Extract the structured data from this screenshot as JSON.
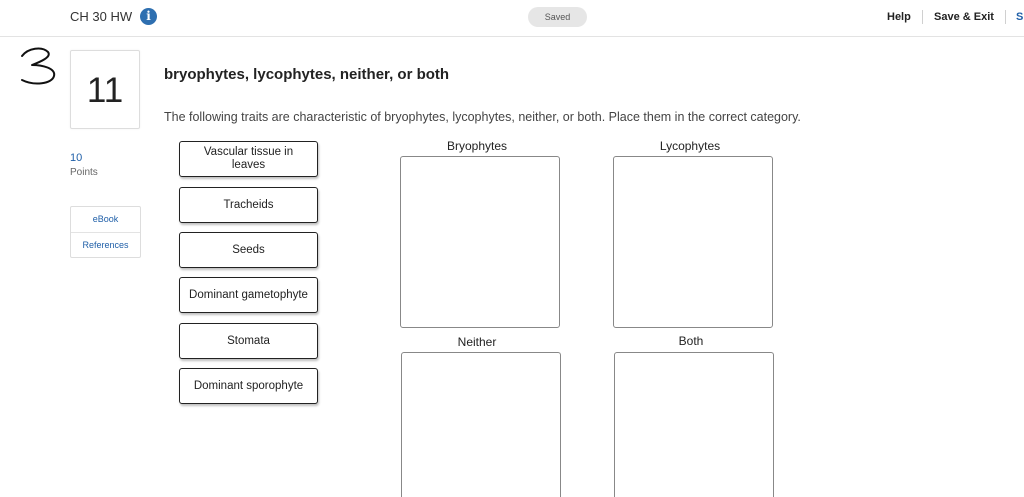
{
  "header": {
    "assignment_title": "CH 30 HW",
    "info_icon": "info-icon",
    "saved_label": "Saved",
    "help_label": "Help",
    "save_exit_label": "Save & Exit",
    "submit_partial_label": "S"
  },
  "sidebar": {
    "question_number": "11",
    "points_value": "10",
    "points_label": "Points",
    "resources": [
      "eBook",
      "References"
    ]
  },
  "question": {
    "title": "bryophytes, lycophytes, neither, or both",
    "instructions": "The following traits are characteristic of bryophytes, lycophytes, neither, or both. Place them in the correct category."
  },
  "tiles": [
    "Vascular tissue in leaves",
    "Tracheids",
    "Seeds",
    "Dominant gametophyte",
    "Stomata",
    "Dominant sporophyte"
  ],
  "categories": [
    "Bryophytes",
    "Lycophytes",
    "Neither",
    "Both"
  ],
  "colors": {
    "accent_blue": "#1f5fa8",
    "info_blue": "#2e6fb0",
    "tile_border": "#222222"
  }
}
